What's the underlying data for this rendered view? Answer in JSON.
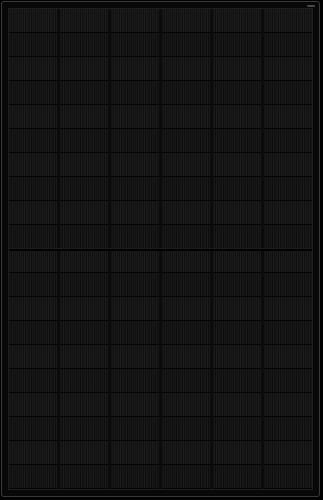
{
  "image": {
    "subject": "solar-panel",
    "colors": {
      "frame": "#3a3a3a",
      "cells": "#181818",
      "background": "#000000"
    },
    "layout": {
      "cell_columns": 6,
      "cells_per_column": 20,
      "split_halves": 2
    }
  }
}
